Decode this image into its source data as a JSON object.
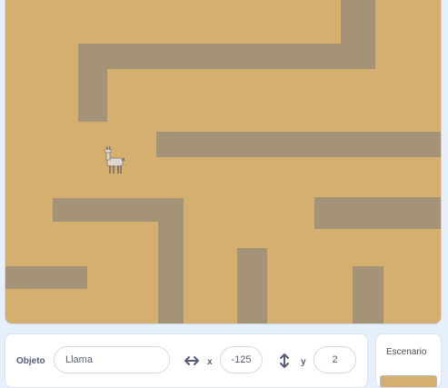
{
  "sprite_info": {
    "object_label": "Objeto",
    "object_name": "Llama",
    "x_label": "x",
    "x_value": "-125",
    "y_label": "y",
    "y_value": "2"
  },
  "stage_panel": {
    "title": "Escenario"
  },
  "icons": {
    "x_icon": "horizontal-arrows-icon",
    "y_icon": "vertical-arrows-icon",
    "sprite": "llama-sprite"
  },
  "colors": {
    "maze_background": "#d4af6f",
    "maze_wall": "#a59378",
    "ui_text": "#575e75"
  }
}
